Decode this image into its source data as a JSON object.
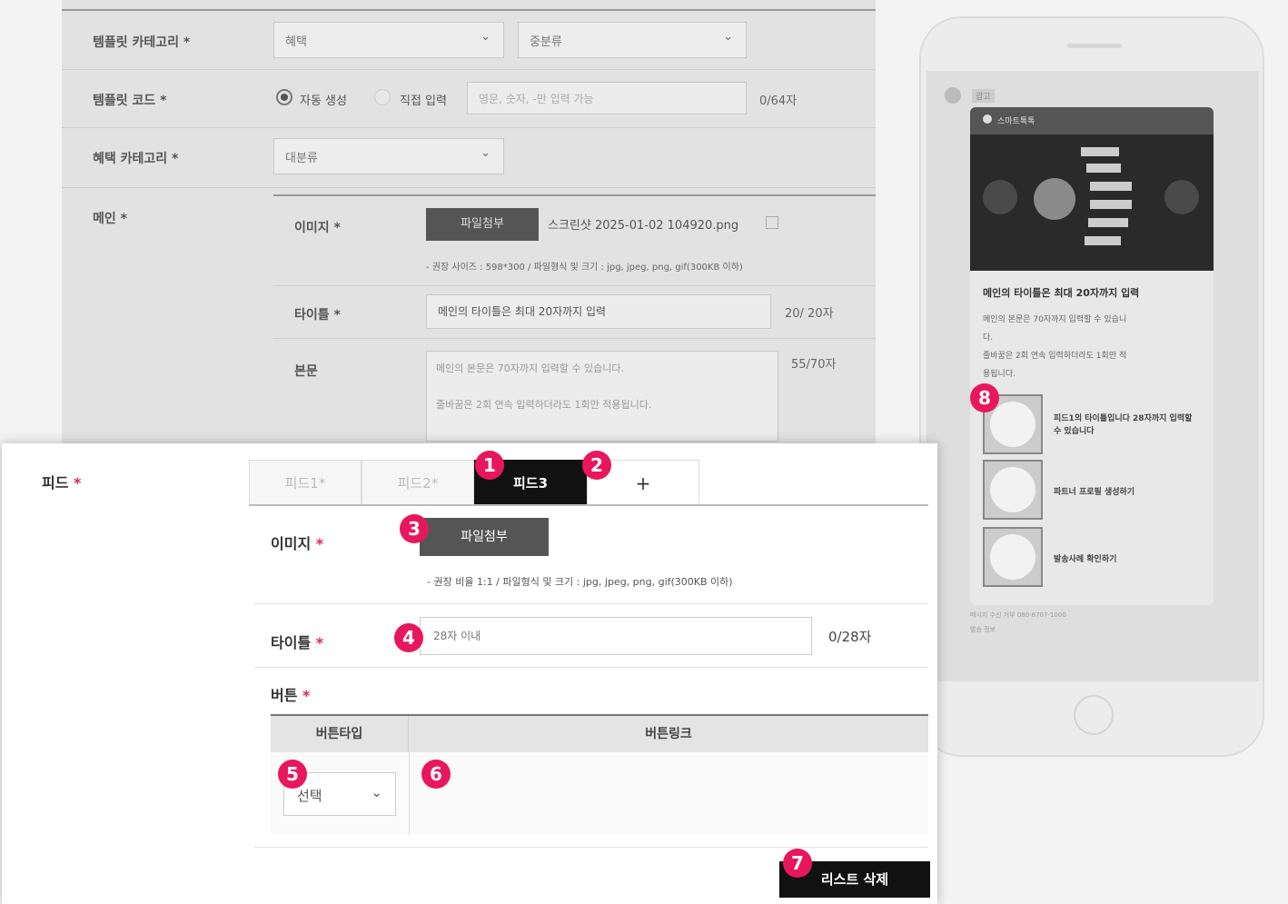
{
  "template_form": {
    "category_label": "템플릿 카테고리",
    "category_major": "혜택",
    "category_minor": "중분류",
    "code_label": "템플릿 코드",
    "code_auto": "자동 생성",
    "code_manual": "직접 입력",
    "code_placeholder": "영문, 숫자, -만 입력 가능",
    "code_count": "0/64자",
    "benefit_label": "혜택 카테고리",
    "benefit_major": "대분류",
    "main_label": "메인",
    "image_label": "이미지",
    "attach_label": "파일첨부",
    "file_name": "스크린샷 2025-01-02 104920.png",
    "image_note": "- 권장 사이즈 : 598*300 / 파일형식 및 크기 : jpg, jpeg, png, gif(300KB 이하)",
    "title_label": "타이틀",
    "title_value": "메인의 타이틀은 최대 20자까지 입력",
    "title_count": "20/ 20자",
    "body_label": "본문",
    "body_line1": "메인의 본문은 70자까지 입력할 수 있습니다.",
    "body_line2": "줄바꿈은 2회 연속 입력하더라도 1회만 적용됩니다.",
    "body_count": "55/70자"
  },
  "feed": {
    "label": "피드",
    "required_mark": "*",
    "tabs": [
      "피드1*",
      "피드2*",
      "피드3",
      "+"
    ],
    "image_label": "이미지",
    "attach_button": "파일첨부",
    "image_note": "- 권장 비율 1:1 / 파일형식 및 크기 : jpg, jpeg, png, gif(300KB 이하)",
    "title_label": "타이틀",
    "title_placeholder": "28자 이내",
    "title_count": "0/28자",
    "button_label": "버튼",
    "col_type": "버튼타입",
    "col_link": "버튼링크",
    "select_value": "선택",
    "delete_button": "리스트 삭제"
  },
  "preview": {
    "sender": "광고",
    "card_header": "스마트톡톡",
    "main_title": "메인의 타이틀은 최대 20자까지 입력",
    "main_body1": "메인의 본문은 70자까지 입력할 수 있습니",
    "main_body2": "다.",
    "main_body3": "줄바꿈은 2회 연속 입력하더라도 1회만 적",
    "main_body4": "용됩니다.",
    "feed_items": [
      "피드1의 타이틀입니다 28자까지 입력할 수 있습니다",
      "파트너 프로필 생성하기",
      "발송사례 확인하기"
    ],
    "footer1": "메시지 수신 거부 080-8707-1000",
    "footer2": "발송 정보"
  },
  "markers": [
    "1",
    "2",
    "3",
    "4",
    "5",
    "6",
    "7",
    "8"
  ],
  "colors": {
    "marker": "#e8175d",
    "active_tab": "#111111",
    "required": "#e0245e"
  }
}
